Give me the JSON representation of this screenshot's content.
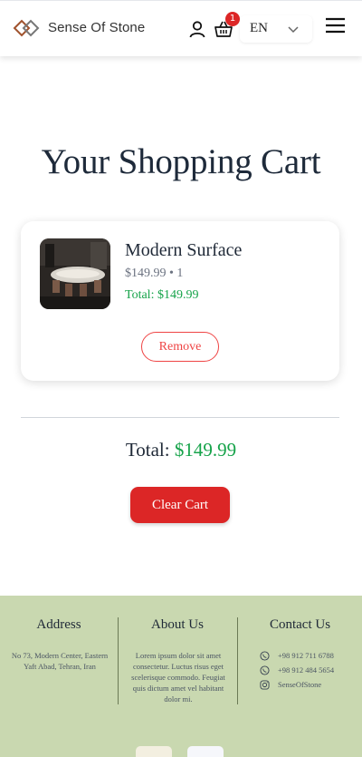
{
  "header": {
    "brand": "Sense Of Stone",
    "cart_count": "1",
    "language": "EN"
  },
  "page": {
    "title": "Your Shopping Cart"
  },
  "cart": {
    "items": [
      {
        "name": "Modern Surface",
        "price_qty": "$149.99 • 1",
        "total": "Total: $149.99",
        "remove_label": "Remove"
      }
    ],
    "total_label": "Total: ",
    "total_value": "$149.99",
    "clear_label": "Clear Cart"
  },
  "footer": {
    "address_title": "Address",
    "address_text": "No 73, Modern Center, Eastern Yaft Abad, Tehran, Iran",
    "about_title": "About Us",
    "about_text": "Lorem ipsum dolor sit amet consectetur. Luctus risus eget scelerisque commodo. Feugiat quis dictum amet vel habitant dolor mi.",
    "contact_title": "Contact Us",
    "contacts": [
      {
        "icon": "whatsapp-icon",
        "text": "+98 912 711 6788"
      },
      {
        "icon": "whatsapp-icon",
        "text": "+98 912 484 5654"
      },
      {
        "icon": "instagram-icon",
        "text": "SenseOfStone"
      }
    ]
  },
  "colors": {
    "accent_red": "#dc2626",
    "price_green": "#16a34a",
    "footer_bg": "#c9d8b0"
  }
}
